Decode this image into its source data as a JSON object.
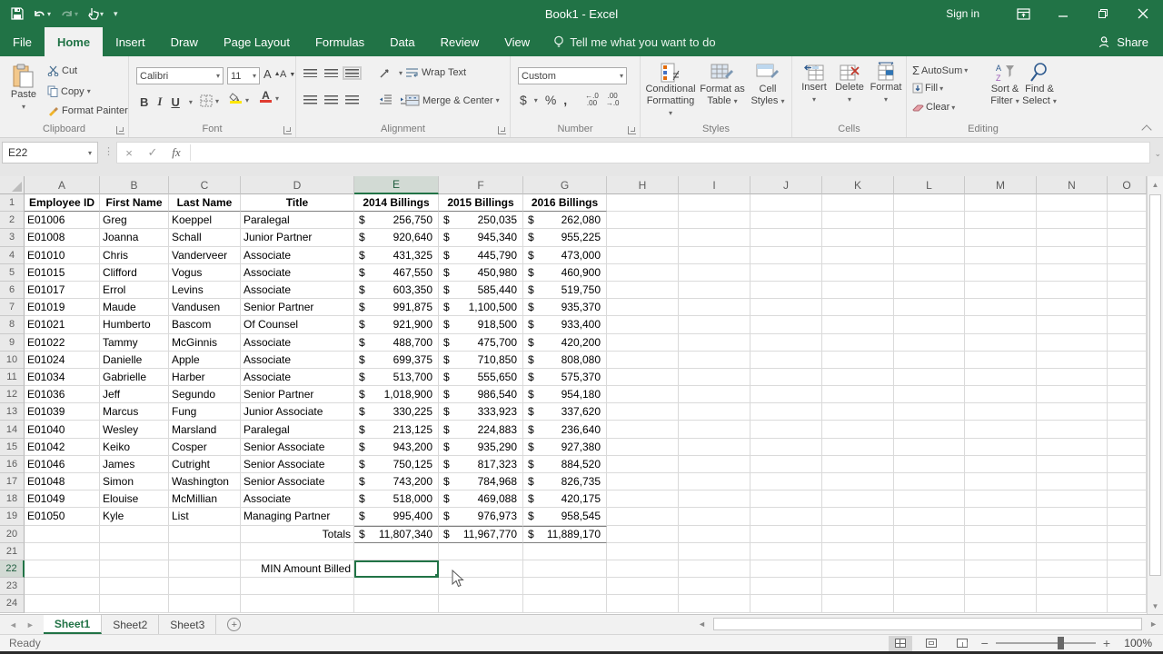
{
  "titlebar": {
    "title": "Book1 - Excel",
    "sign_in": "Sign in"
  },
  "tabs": {
    "items": [
      "File",
      "Home",
      "Insert",
      "Draw",
      "Page Layout",
      "Formulas",
      "Data",
      "Review",
      "View"
    ],
    "active": "Home",
    "tell_me": "Tell me what you want to do",
    "share": "Share"
  },
  "ribbon": {
    "clipboard": {
      "label": "Clipboard",
      "paste": "Paste",
      "cut": "Cut",
      "copy": "Copy",
      "format_painter": "Format Painter"
    },
    "font": {
      "label": "Font",
      "family": "Calibri",
      "size": "11",
      "bold": "B",
      "italic": "I",
      "underline": "U",
      "grow": "A",
      "shrink": "A",
      "color_letter": "A"
    },
    "alignment": {
      "label": "Alignment",
      "wrap": "Wrap Text",
      "merge": "Merge & Center"
    },
    "number": {
      "label": "Number",
      "format": "Custom",
      "currency": "$",
      "percent": "%",
      "comma": ",",
      "inc_dec": ".00",
      "dec_dec": ".0"
    },
    "styles": {
      "label": "Styles",
      "conditional1": "Conditional",
      "conditional2": "Formatting",
      "table1": "Format as",
      "table2": "Table",
      "cellstyles1": "Cell",
      "cellstyles2": "Styles"
    },
    "cells": {
      "label": "Cells",
      "insert": "Insert",
      "delete": "Delete",
      "format": "Format"
    },
    "editing": {
      "label": "Editing",
      "autosum_icon": "Σ",
      "autosum": "AutoSum",
      "fill": "Fill",
      "clear": "Clear",
      "sort1": "Sort &",
      "sort2": "Filter",
      "find1": "Find &",
      "find2": "Select",
      "az_a": "A",
      "az_z": "Z"
    }
  },
  "formula_bar": {
    "name_box": "E22",
    "cancel": "×",
    "enter": "✓",
    "fx": "fx",
    "value": ""
  },
  "sheet": {
    "columns": [
      "A",
      "B",
      "C",
      "D",
      "E",
      "F",
      "G",
      "H",
      "I",
      "J",
      "K",
      "L",
      "M",
      "N",
      "O"
    ],
    "selected_column": "E",
    "selected_row": 22,
    "row_count": 24,
    "currency_symbol": "$",
    "header_row": [
      "Employee ID",
      "First Name",
      "Last Name",
      "Title",
      "2014 Billings",
      "2015 Billings",
      "2016 Billings"
    ],
    "employees": [
      [
        "E01006",
        "Greg",
        "Koeppel",
        "Paralegal",
        "256,750",
        "250,035",
        "262,080"
      ],
      [
        "E01008",
        "Joanna",
        "Schall",
        "Junior Partner",
        "920,640",
        "945,340",
        "955,225"
      ],
      [
        "E01010",
        "Chris",
        "Vanderveer",
        "Associate",
        "431,325",
        "445,790",
        "473,000"
      ],
      [
        "E01015",
        "Clifford",
        "Vogus",
        "Associate",
        "467,550",
        "450,980",
        "460,900"
      ],
      [
        "E01017",
        "Errol",
        "Levins",
        "Associate",
        "603,350",
        "585,440",
        "519,750"
      ],
      [
        "E01019",
        "Maude",
        "Vandusen",
        "Senior Partner",
        "991,875",
        "1,100,500",
        "935,370"
      ],
      [
        "E01021",
        "Humberto",
        "Bascom",
        "Of Counsel",
        "921,900",
        "918,500",
        "933,400"
      ],
      [
        "E01022",
        "Tammy",
        "McGinnis",
        "Associate",
        "488,700",
        "475,700",
        "420,200"
      ],
      [
        "E01024",
        "Danielle",
        "Apple",
        "Associate",
        "699,375",
        "710,850",
        "808,080"
      ],
      [
        "E01034",
        "Gabrielle",
        "Harber",
        "Associate",
        "513,700",
        "555,650",
        "575,370"
      ],
      [
        "E01036",
        "Jeff",
        "Segundo",
        "Senior Partner",
        "1,018,900",
        "986,540",
        "954,180"
      ],
      [
        "E01039",
        "Marcus",
        "Fung",
        "Junior Associate",
        "330,225",
        "333,923",
        "337,620"
      ],
      [
        "E01040",
        "Wesley",
        "Marsland",
        "Paralegal",
        "213,125",
        "224,883",
        "236,640"
      ],
      [
        "E01042",
        "Keiko",
        "Cosper",
        "Senior Associate",
        "943,200",
        "935,290",
        "927,380"
      ],
      [
        "E01046",
        "James",
        "Cutright",
        "Senior Associate",
        "750,125",
        "817,323",
        "884,520"
      ],
      [
        "E01048",
        "Simon",
        "Washington",
        "Senior Associate",
        "743,200",
        "784,968",
        "826,735"
      ],
      [
        "E01049",
        "Elouise",
        "McMillian",
        "Associate",
        "518,000",
        "469,088",
        "420,175"
      ],
      [
        "E01050",
        "Kyle",
        "List",
        "Managing Partner",
        "995,400",
        "976,973",
        "958,545"
      ]
    ],
    "totals_label": "Totals",
    "totals": [
      "11,807,340",
      "11,967,770",
      "11,889,170"
    ],
    "min_label": "MIN Amount Billed"
  },
  "sheet_tabs": {
    "items": [
      "Sheet1",
      "Sheet2",
      "Sheet3"
    ],
    "active": "Sheet1"
  },
  "status_bar": {
    "mode": "Ready",
    "zoom": "100%"
  },
  "colors": {
    "accent": "#217346",
    "grid_line": "#dadada",
    "header_bg": "#e9e9e9",
    "totals_border": "#7f7f7f",
    "fill_yellow": "#ffe600",
    "font_red": "#e03c31"
  }
}
